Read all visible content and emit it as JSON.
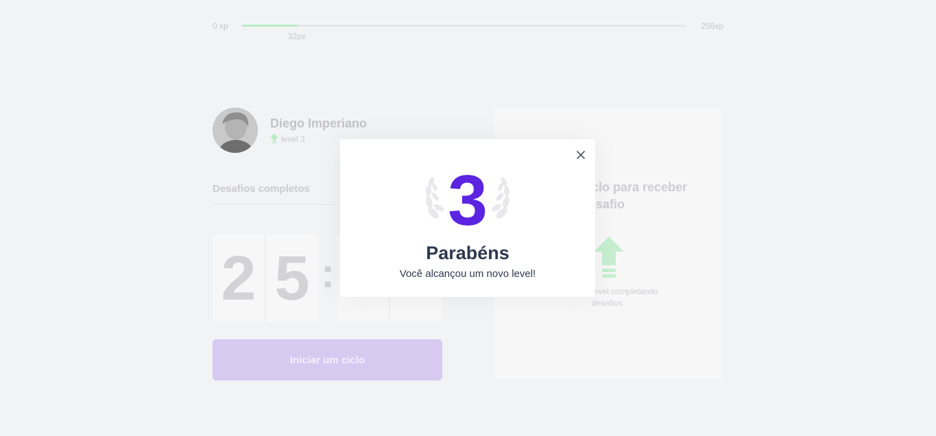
{
  "xp": {
    "min_label": "0 xp",
    "max_label": "256xp",
    "current_label": "32px",
    "progress": 0.125,
    "fill_color": "#b6ecc1"
  },
  "profile": {
    "name": "Diego Imperiano",
    "level_label": "level 3"
  },
  "challenges": {
    "completed_label": "Desafios completos"
  },
  "countdown": {
    "minutes": [
      "2",
      "5"
    ],
    "colon": ":"
  },
  "start_button": {
    "label": "Iniciar um ciclo"
  },
  "challenge_box": {
    "text": "ciclo para receber desafio",
    "hint": "level completando desafios"
  },
  "modal": {
    "level": "3",
    "title": "Parabéns",
    "subtitle": "Você alcançou um novo level!",
    "close_icon": "close-icon",
    "accent_color": "#5b24e0"
  }
}
